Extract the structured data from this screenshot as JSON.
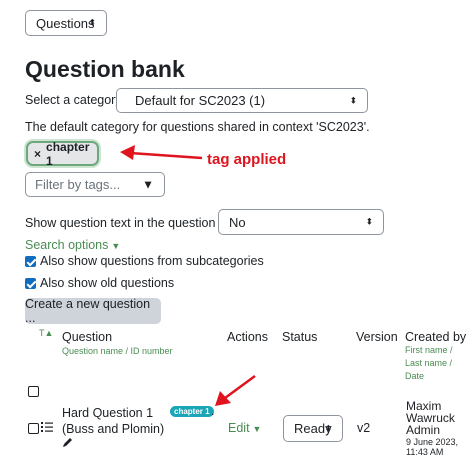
{
  "top_select": {
    "value": "Questions"
  },
  "title": "Question bank",
  "category": {
    "label": "Select a category:",
    "value": "Default for SC2023 (1)",
    "description": "The default category for questions shared in context 'SC2023'."
  },
  "tag_filter": {
    "applied_tag": "chapter 1",
    "remove_symbol": "×",
    "placeholder": "Filter by tags..."
  },
  "annotation": {
    "note": "tag applied",
    "color": "#e0141e"
  },
  "show_text": {
    "label": "Show question text in the question list?",
    "value": "No"
  },
  "search_options": {
    "label": "Search options"
  },
  "options": {
    "subcategories": {
      "label": "Also show questions from subcategories",
      "checked": true
    },
    "old_questions": {
      "label": "Also show old questions",
      "checked": true
    }
  },
  "create_button": {
    "label": "Create a new question ..."
  },
  "table": {
    "sort_indicator": "T",
    "headers": {
      "question": "Question",
      "question_sub": "Question name / ID number",
      "actions": "Actions",
      "status": "Status",
      "version": "Version",
      "created_by": "Created by",
      "created_by_sub": "First name / Last name / Date"
    },
    "rows": [
      {
        "name": "Hard Question 1",
        "id": "(Buss and Plomin)",
        "tag": "chapter 1",
        "tag_suffix": ".",
        "action": "Edit",
        "status": "Ready",
        "version": "v2",
        "creator_first": "Maxim",
        "creator_last": "Wawruck",
        "creator_role": "Admin",
        "date": "9 June 2023,",
        "time": "11:43 AM"
      }
    ]
  },
  "colors": {
    "link": "#4b8c53",
    "tag_badge": "#1aa6b7",
    "checkbox": "#0f6cbf",
    "button": "#ced4da"
  }
}
